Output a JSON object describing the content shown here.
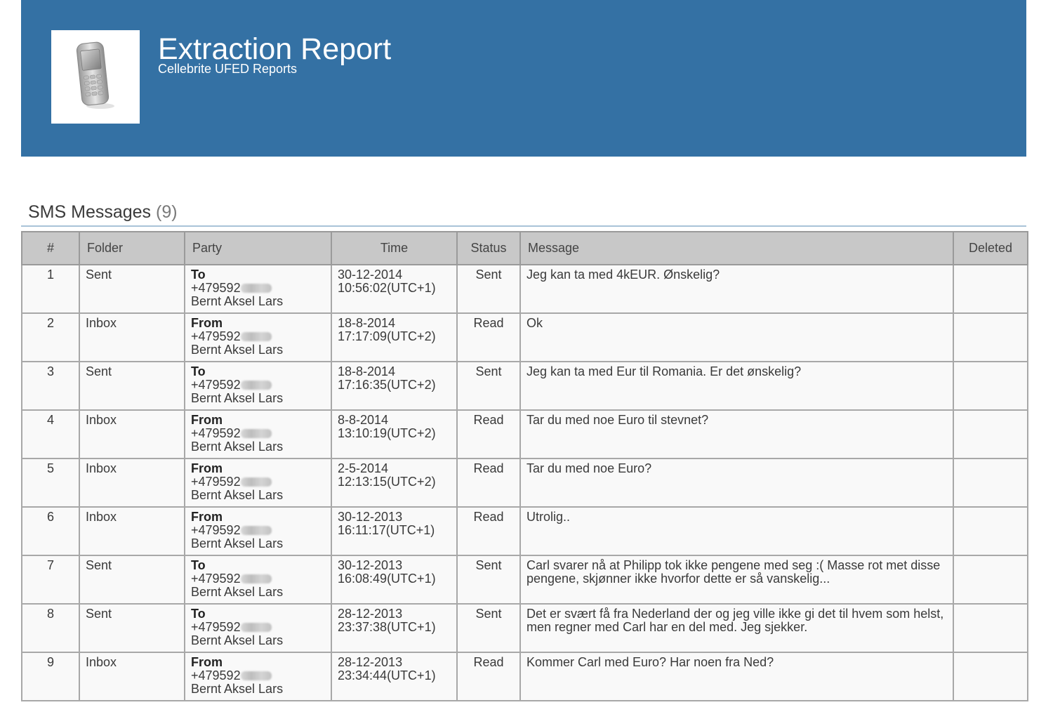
{
  "header": {
    "title": "Extraction Report",
    "subtitle": "Cellebrite UFED Reports",
    "logo_icon": "mobile-phone-icon",
    "background_color": "#3471a4"
  },
  "section": {
    "title": "SMS Messages",
    "count": "(9)"
  },
  "table": {
    "columns": {
      "num": "#",
      "folder": "Folder",
      "party": "Party",
      "time": "Time",
      "status": "Status",
      "message": "Message",
      "deleted": "Deleted"
    },
    "rows": [
      {
        "num": "1",
        "folder": "Sent",
        "direction": "To",
        "number": "+479592",
        "name": "Bernt Aksel Lars",
        "date": "30-12-2014",
        "clock": "10:56:02(UTC+1)",
        "status": "Sent",
        "message": "Jeg kan ta med 4kEUR. Ønskelig?",
        "deleted": ""
      },
      {
        "num": "2",
        "folder": "Inbox",
        "direction": "From",
        "number": "+479592",
        "name": "Bernt Aksel Lars",
        "date": "18-8-2014",
        "clock": "17:17:09(UTC+2)",
        "status": "Read",
        "message": "Ok",
        "deleted": ""
      },
      {
        "num": "3",
        "folder": "Sent",
        "direction": "To",
        "number": "+479592",
        "name": "Bernt Aksel Lars",
        "date": "18-8-2014",
        "clock": "17:16:35(UTC+2)",
        "status": "Sent",
        "message": "Jeg kan ta med Eur til Romania. Er det ønskelig?",
        "deleted": ""
      },
      {
        "num": "4",
        "folder": "Inbox",
        "direction": "From",
        "number": "+479592",
        "name": "Bernt Aksel Lars",
        "date": "8-8-2014",
        "clock": "13:10:19(UTC+2)",
        "status": "Read",
        "message": "Tar du med noe Euro til stevnet?",
        "deleted": ""
      },
      {
        "num": "5",
        "folder": "Inbox",
        "direction": "From",
        "number": "+479592",
        "name": "Bernt Aksel Lars",
        "date": "2-5-2014",
        "clock": "12:13:15(UTC+2)",
        "status": "Read",
        "message": "Tar du med noe Euro?",
        "deleted": ""
      },
      {
        "num": "6",
        "folder": "Inbox",
        "direction": "From",
        "number": "+479592",
        "name": "Bernt Aksel Lars",
        "date": "30-12-2013",
        "clock": "16:11:17(UTC+1)",
        "status": "Read",
        "message": "Utrolig..",
        "deleted": ""
      },
      {
        "num": "7",
        "folder": "Sent",
        "direction": "To",
        "number": "+479592",
        "name": "Bernt Aksel Lars",
        "date": "30-12-2013",
        "clock": "16:08:49(UTC+1)",
        "status": "Sent",
        "message": "Carl svarer nå at Philipp tok ikke pengene med seg :( Masse rot met disse pengene, skjønner ikke hvorfor dette er så vanskelig...",
        "deleted": ""
      },
      {
        "num": "8",
        "folder": "Sent",
        "direction": "To",
        "number": "+479592",
        "name": "Bernt Aksel Lars",
        "date": "28-12-2013",
        "clock": "23:37:38(UTC+1)",
        "status": "Sent",
        "message": "Det er svært få fra Nederland der og jeg ville ikke gi det til hvem som helst, men regner med Carl har en del med. Jeg sjekker.",
        "deleted": ""
      },
      {
        "num": "9",
        "folder": "Inbox",
        "direction": "From",
        "number": "+479592",
        "name": "Bernt Aksel Lars",
        "date": "28-12-2013",
        "clock": "23:34:44(UTC+1)",
        "status": "Read",
        "message": "Kommer Carl med Euro? Har noen fra Ned?",
        "deleted": ""
      }
    ]
  }
}
